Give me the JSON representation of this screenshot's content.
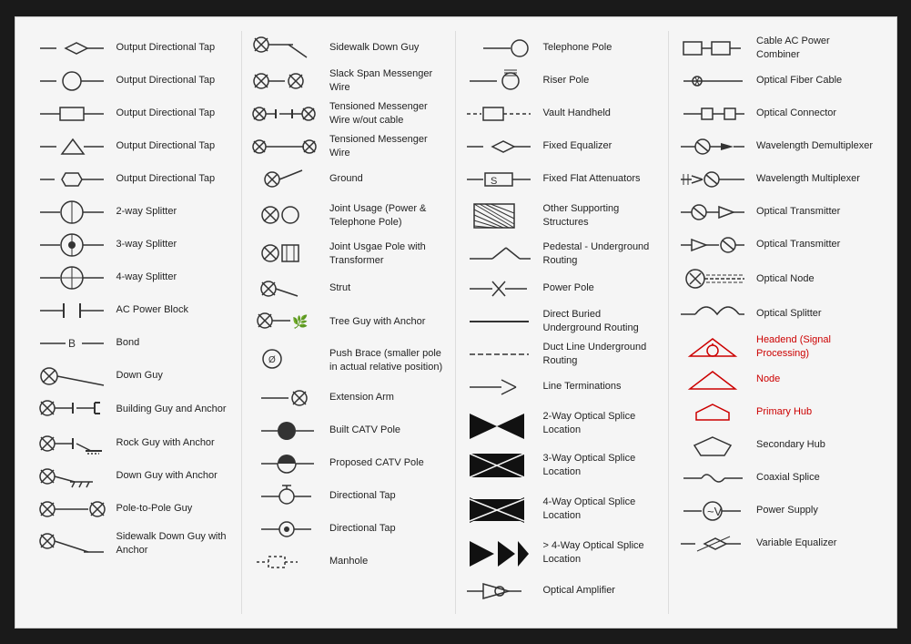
{
  "columns": [
    {
      "items": [
        {
          "id": "output-tap-diamond",
          "label": "Output Directional Tap"
        },
        {
          "id": "output-tap-circle",
          "label": "Output Directional Tap"
        },
        {
          "id": "output-tap-square",
          "label": "Output Directional Tap"
        },
        {
          "id": "output-tap-triangle",
          "label": "Output Directional Tap"
        },
        {
          "id": "output-tap-hex",
          "label": "Output Directional Tap"
        },
        {
          "id": "splitter-2way",
          "label": "2-way Splitter"
        },
        {
          "id": "splitter-3way",
          "label": "3-way Splitter"
        },
        {
          "id": "splitter-4way",
          "label": "4-way Splitter"
        },
        {
          "id": "ac-power-block",
          "label": "AC Power Block"
        },
        {
          "id": "bond",
          "label": "Bond"
        },
        {
          "id": "down-guy",
          "label": "Down Guy"
        },
        {
          "id": "building-guy-anchor",
          "label": "Building Guy and Anchor"
        },
        {
          "id": "rock-guy-anchor",
          "label": "Rock Guy with Anchor"
        },
        {
          "id": "down-guy-anchor",
          "label": "Down Guy with Anchor"
        },
        {
          "id": "pole-to-pole-guy",
          "label": "Pole-to-Pole Guy"
        },
        {
          "id": "sidewalk-down-guy-anchor",
          "label": "Sidewalk Down Guy with Anchor"
        }
      ]
    },
    {
      "items": [
        {
          "id": "sidewalk-down-guy",
          "label": "Sidewalk Down Guy"
        },
        {
          "id": "slack-span-messenger",
          "label": "Slack Span Messenger Wire"
        },
        {
          "id": "tensioned-messenger-wo-cable",
          "label": "Tensioned Messenger Wire w/out cable"
        },
        {
          "id": "tensioned-messenger",
          "label": "Tensioned Messenger Wire"
        },
        {
          "id": "ground",
          "label": "Ground"
        },
        {
          "id": "joint-usage",
          "label": "Joint Usage (Power & Telephone Pole)"
        },
        {
          "id": "joint-usgae-transformer",
          "label": "Joint Usgae Pole with Transformer"
        },
        {
          "id": "strut",
          "label": "Strut"
        },
        {
          "id": "tree-guy-anchor",
          "label": "Tree Guy with Anchor"
        },
        {
          "id": "push-brace",
          "label": "Push Brace (smaller pole in actual relative position)"
        },
        {
          "id": "extension-arm",
          "label": "Extension Arm"
        },
        {
          "id": "built-catv-pole",
          "label": "Built CATV Pole"
        },
        {
          "id": "proposed-catv-pole",
          "label": "Proposed CATV Pole"
        },
        {
          "id": "directional-tap-1",
          "label": "Directional Tap"
        },
        {
          "id": "directional-tap-2",
          "label": "Directional Tap"
        },
        {
          "id": "manhole",
          "label": "Manhole"
        }
      ]
    },
    {
      "items": [
        {
          "id": "telephone-pole",
          "label": "Telephone Pole"
        },
        {
          "id": "riser-pole",
          "label": "Riser Pole"
        },
        {
          "id": "vault-handheld",
          "label": "Vault Handheld"
        },
        {
          "id": "fixed-equalizer",
          "label": "Fixed Equalizer"
        },
        {
          "id": "fixed-flat-attenuators",
          "label": "Fixed Flat Attenuators"
        },
        {
          "id": "other-supporting",
          "label": "Other Supporting Structures"
        },
        {
          "id": "pedestal-underground",
          "label": "Pedestal - Underground Routing"
        },
        {
          "id": "power-pole",
          "label": "Power Pole"
        },
        {
          "id": "direct-buried",
          "label": "Direct Buried Underground Routing"
        },
        {
          "id": "duct-line",
          "label": "Duct Line Underground Routing"
        },
        {
          "id": "line-terminations",
          "label": "Line Terminations"
        },
        {
          "id": "splice-2way",
          "label": "2-Way Optical Splice Location"
        },
        {
          "id": "splice-3way",
          "label": "3-Way Optical Splice Location"
        },
        {
          "id": "splice-4way",
          "label": "4-Way Optical Splice Location"
        },
        {
          "id": "splice-gt4way",
          "label": "> 4-Way Optical Splice Location"
        },
        {
          "id": "optical-amplifier",
          "label": "Optical Amplifier"
        }
      ]
    },
    {
      "items": [
        {
          "id": "cable-ac-power",
          "label": "Cable AC Power Combiner"
        },
        {
          "id": "optical-fiber-cable",
          "label": "Optical Fiber Cable"
        },
        {
          "id": "optical-connector",
          "label": "Optical Connector"
        },
        {
          "id": "wavelength-demux",
          "label": "Wavelength Demultiplexer"
        },
        {
          "id": "wavelength-mux",
          "label": "Wavelength Multiplexer"
        },
        {
          "id": "optical-transmitter-1",
          "label": "Optical Transmitter"
        },
        {
          "id": "optical-transmitter-2",
          "label": "Optical Transmitter"
        },
        {
          "id": "optical-node",
          "label": "Optical Node"
        },
        {
          "id": "optical-splitter",
          "label": "Optical Splitter"
        },
        {
          "id": "headend",
          "label": "Headend (Signal Processing)",
          "red": true
        },
        {
          "id": "node",
          "label": "Node",
          "red": true
        },
        {
          "id": "primary-hub",
          "label": "Primary Hub",
          "red": true
        },
        {
          "id": "secondary-hub",
          "label": "Secondary Hub",
          "red": true
        },
        {
          "id": "coaxial-splice",
          "label": "Coaxial Splice"
        },
        {
          "id": "power-supply",
          "label": "Power Supply"
        },
        {
          "id": "variable-equalizer",
          "label": "Variable Equalizer"
        }
      ]
    }
  ]
}
